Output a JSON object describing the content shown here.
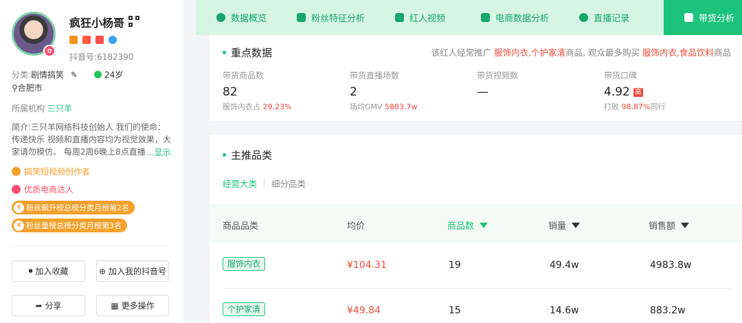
{
  "profile": {
    "nickname": "疯狂小杨哥",
    "douyin_id": "抖音号:6182390",
    "category_label": "分类:",
    "category_value": "剧情搞笑",
    "age": "24岁",
    "location": "合肥市",
    "org_label": "所属机构",
    "org_value": "三只羊",
    "bio": "简介:三只羊网络科技创始人 我们的使命：传递快乐 视频和直播内容均为视觉效果，大家请勿模仿。 每周2周6晚上8点直播",
    "bio_more": "...显示",
    "tags": [
      {
        "label": "搞笑短视频创作者",
        "color": "#f6a02b"
      },
      {
        "label": "优质电商达人",
        "color": "#ff4d6d"
      }
    ],
    "ranks": [
      {
        "label": "粉丝飙升榜总榜分类月榜第2名"
      },
      {
        "label": "粉丝量榜总榜分类月榜第3名"
      }
    ],
    "buttons": {
      "favorite": "加入收藏",
      "add_account": "加入我的抖音号",
      "share": "分享",
      "more": "更多操作"
    }
  },
  "tabs": [
    {
      "label": "数据概览",
      "icon": "pie-icon"
    },
    {
      "label": "粉丝特征分析",
      "icon": "user-card-icon"
    },
    {
      "label": "红人视频",
      "icon": "video-icon"
    },
    {
      "label": "电商数据分析",
      "icon": "bag-icon"
    },
    {
      "label": "直播记录",
      "icon": "clock-icon"
    },
    {
      "label": "带货分析",
      "icon": "shop-icon",
      "active": true
    }
  ],
  "key_data": {
    "title": "重点数据",
    "promo_prefix": "该红人经常推广",
    "promo_hl1": "服饰内衣,个护家清",
    "promo_mid": "商品, 观众最多购买",
    "promo_hl2": "服饰内衣,食品饮料",
    "promo_suffix": "商品",
    "kpis": [
      {
        "label": "带货商品数",
        "value": "82",
        "sub_prefix": "服饰内衣占",
        "sub_value": "29.23%",
        "sub_suffix": ""
      },
      {
        "label": "带货直播场数",
        "value": "2",
        "sub_prefix": "场均GMV",
        "sub_value": "5883.7w",
        "sub_suffix": ""
      },
      {
        "label": "带货视频数",
        "value": "—",
        "sub_prefix": "",
        "sub_value": "",
        "sub_suffix": ""
      },
      {
        "label": "带货口碑",
        "value": "4.92",
        "badge": "高",
        "sub_prefix": "打败",
        "sub_value": "98.87%",
        "sub_suffix": "同行"
      }
    ]
  },
  "main_category": {
    "title": "主推品类",
    "subtab_active": "经营大类",
    "subtab_other": "细分品类",
    "columns": [
      "商品品类",
      "均价",
      "商品数",
      "销量",
      "销售额"
    ],
    "rows": [
      {
        "category": "服饰内衣",
        "avg_price": "¥104.31",
        "count": "19",
        "sales": "49.4w",
        "revenue": "4983.8w"
      },
      {
        "category": "个护家清",
        "avg_price": "¥49.84",
        "count": "15",
        "sales": "14.6w",
        "revenue": "883.2w"
      }
    ]
  },
  "colors": {
    "accent": "#1cc37a",
    "highlight": "#f04a3c",
    "tab_bg": "#d6f5e4"
  }
}
